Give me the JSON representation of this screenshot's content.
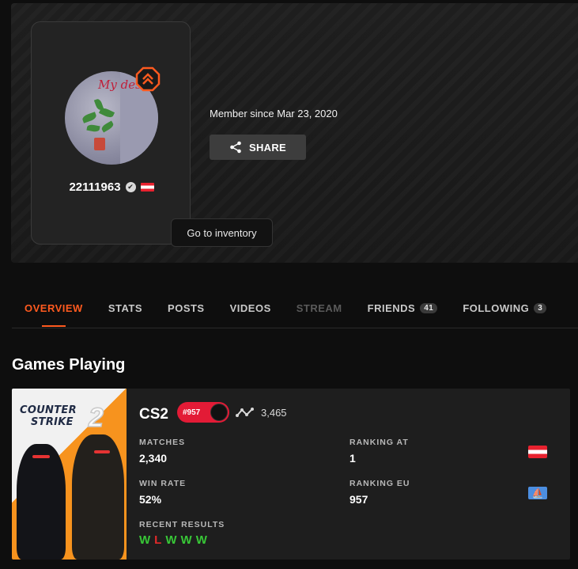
{
  "profile": {
    "username": "22111963",
    "avatar_text": "My destiny",
    "member_since": "Member since Mar 23, 2020",
    "share_label": "SHARE",
    "tooltip": "Go to inventory",
    "flag": "AT"
  },
  "tabs": [
    {
      "label": "OVERVIEW",
      "active": true
    },
    {
      "label": "STATS"
    },
    {
      "label": "POSTS"
    },
    {
      "label": "VIDEOS"
    },
    {
      "label": "STREAM",
      "disabled": true
    },
    {
      "label": "FRIENDS",
      "count": "41"
    },
    {
      "label": "FOLLOWING",
      "count": "3"
    }
  ],
  "section_title": "Games Playing",
  "game": {
    "cover_line1": "COUNTER",
    "cover_line2": "STRIKE",
    "cover_num": "2",
    "name": "CS2",
    "rank": "#957",
    "elo": "3,465",
    "matches_label": "MATCHES",
    "matches_value": "2,340",
    "win_rate_label": "WIN RATE",
    "win_rate_value": "52%",
    "ranking_at_label": "RANKING AT",
    "ranking_at_value": "1",
    "ranking_eu_label": "RANKING EU",
    "ranking_eu_value": "957",
    "recent_label": "RECENT RESULTS",
    "recent": [
      "W",
      "L",
      "W",
      "W",
      "W"
    ]
  },
  "colors": {
    "accent": "#ff5a1f",
    "rank_badge": "#e31b36",
    "win": "#38c737",
    "loss": "#e12a2a"
  }
}
